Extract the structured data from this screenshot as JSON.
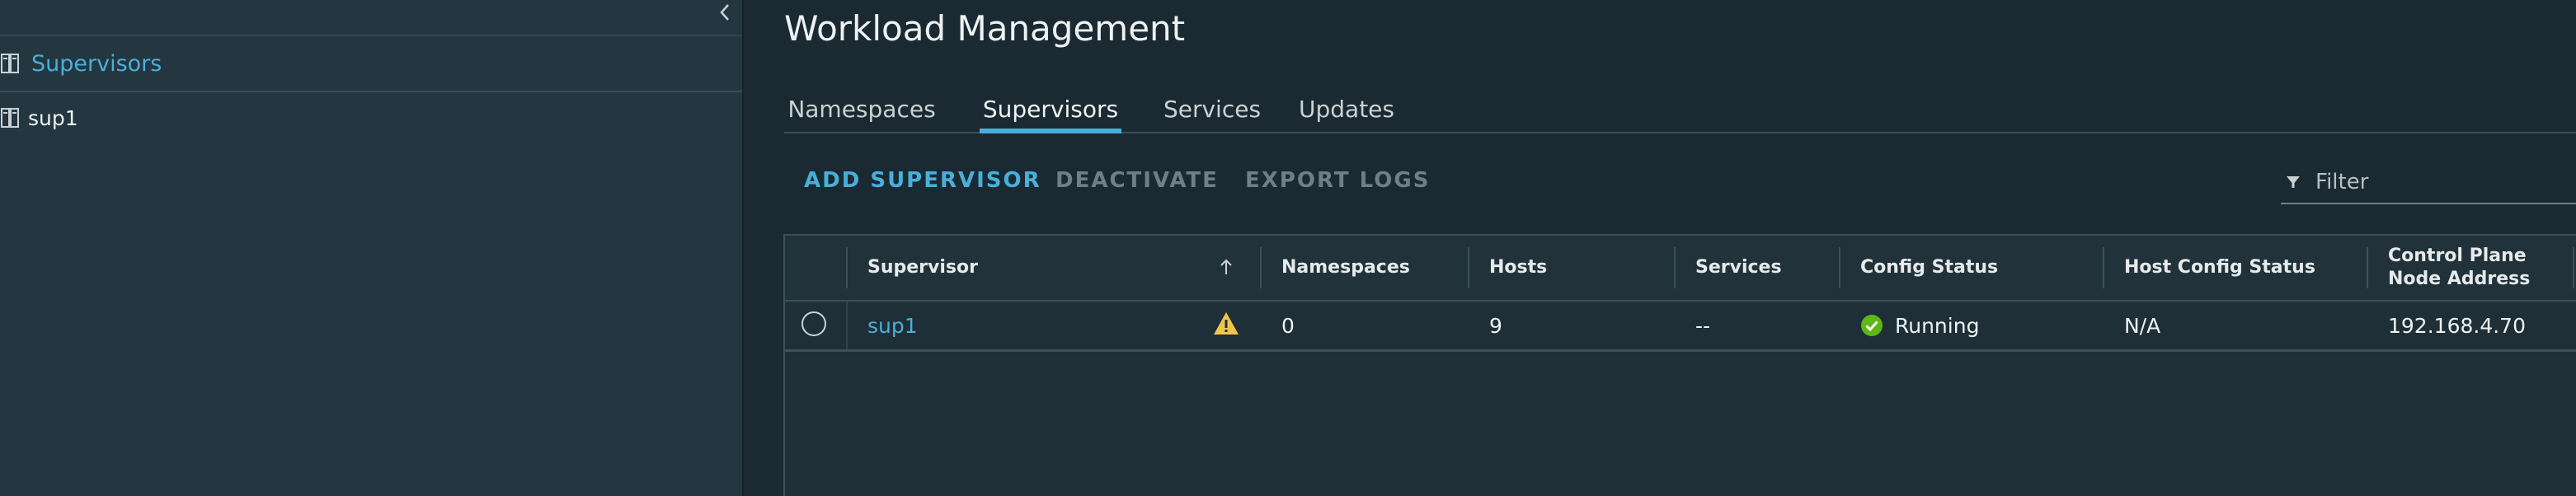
{
  "sidebar": {
    "header_label": "Supervisors",
    "items": [
      {
        "label": "sup1"
      }
    ]
  },
  "main": {
    "title": "Workload Management",
    "tabs": [
      {
        "label": "Namespaces",
        "active": false
      },
      {
        "label": "Supervisors",
        "active": true
      },
      {
        "label": "Services",
        "active": false
      },
      {
        "label": "Updates",
        "active": false
      }
    ],
    "toolbar": {
      "add_label": "ADD SUPERVISOR",
      "deactivate_label": "DEACTIVATE",
      "export_label": "EXPORT LOGS"
    },
    "filter": {
      "placeholder": "Filter"
    },
    "grid": {
      "columns": {
        "supervisor": "Supervisor",
        "namespaces": "Namespaces",
        "hosts": "Hosts",
        "services": "Services",
        "config_status": "Config Status",
        "host_config_status": "Host Config Status",
        "control_plane_line1": "Control Plane",
        "control_plane_line2": "Node Address"
      },
      "rows": [
        {
          "supervisor": "sup1",
          "namespaces": "0",
          "hosts": "9",
          "services": "--",
          "config_status": "Running",
          "host_config_status": "N/A",
          "control_plane_address": "192.168.4.70"
        }
      ]
    }
  },
  "colors": {
    "accent": "#49afd9",
    "success": "#5eb715",
    "warning": "#f0c44b",
    "background": "#1b2a32",
    "sidebar_background": "#243640"
  },
  "icons": {
    "collapse": "chevron-left-icon",
    "server": "server-icon",
    "filter": "filter-icon",
    "sort": "arrow-up-icon",
    "warning": "warning-triangle-icon",
    "success": "check-circle-icon"
  }
}
